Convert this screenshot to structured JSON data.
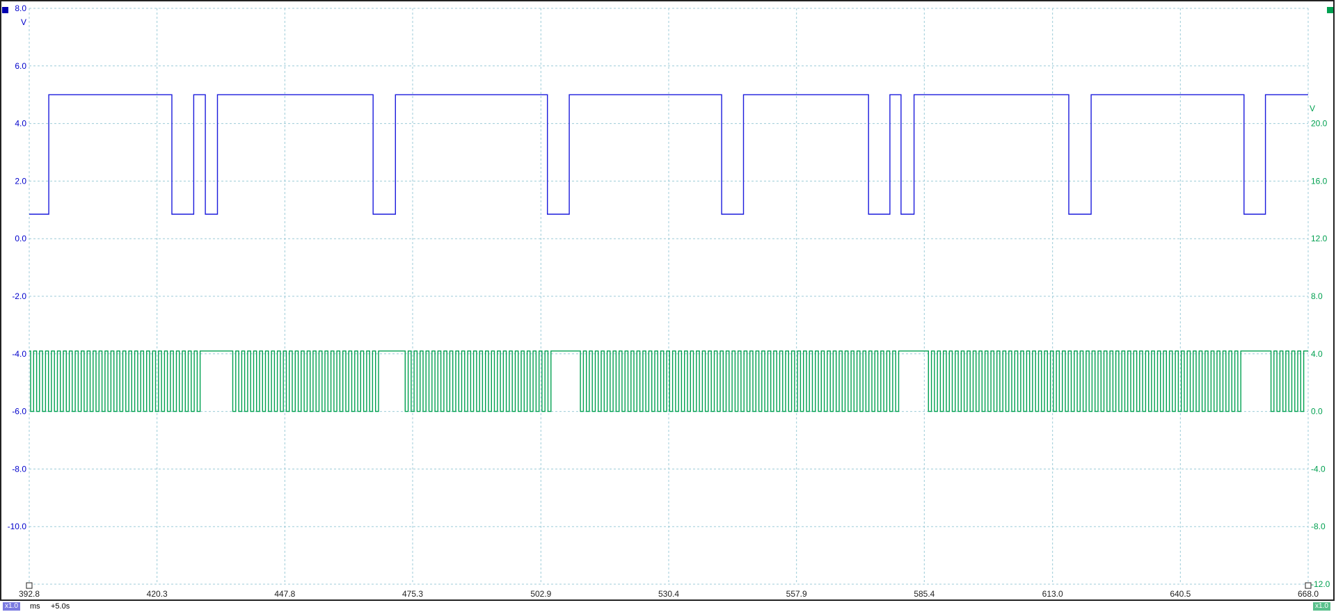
{
  "chart_data": {
    "type": "line",
    "x_unit": "ms",
    "x_range": [
      392.8,
      668.0
    ],
    "x_ticks": [
      "392.8",
      "420.3",
      "447.8",
      "475.3",
      "502.9",
      "530.4",
      "557.9",
      "585.4",
      "613.0",
      "640.5",
      "668.0"
    ],
    "axes": {
      "left": {
        "unit": "V",
        "range": [
          -12.0,
          8.0
        ],
        "ticks": [
          8.0,
          6.0,
          4.0,
          2.0,
          0.0,
          -2.0,
          -4.0,
          -6.0,
          -8.0,
          -10.0
        ],
        "tick_labels": [
          "8.0",
          "6.0",
          "4.0",
          "2.0",
          "0.0",
          "-2.0",
          "-4.0",
          "-6.0",
          "-8.0",
          "-10.0"
        ],
        "color": "#0000cc"
      },
      "right": {
        "unit": "V",
        "range": [
          -12.0,
          28.0
        ],
        "ticks": [
          20.0,
          16.0,
          12.0,
          8.0,
          4.0,
          0.0,
          -4.0,
          -8.0,
          -12.0
        ],
        "tick_labels": [
          "20.0",
          "16.0",
          "12.0",
          "8.0",
          "4.0",
          "0.0",
          "-4.0",
          "-8.0",
          "-12.0"
        ],
        "color": "#00a050"
      }
    },
    "grid": true,
    "series": [
      {
        "axis": "left",
        "color": "#1a1adc",
        "low": 0.85,
        "high": 5.0,
        "segments": [
          [
            392.8,
            0.85
          ],
          [
            397.0,
            5.0
          ],
          [
            423.5,
            0.85
          ],
          [
            428.2,
            5.0
          ],
          [
            430.7,
            0.85
          ],
          [
            433.3,
            5.0
          ],
          [
            466.8,
            0.85
          ],
          [
            471.6,
            5.0
          ],
          [
            504.3,
            0.85
          ],
          [
            509.0,
            5.0
          ],
          [
            541.8,
            0.85
          ],
          [
            546.5,
            5.0
          ],
          [
            573.4,
            0.85
          ],
          [
            578.0,
            5.0
          ],
          [
            580.4,
            0.85
          ],
          [
            583.2,
            5.0
          ],
          [
            616.5,
            0.85
          ],
          [
            621.3,
            5.0
          ],
          [
            654.2,
            0.85
          ],
          [
            658.8,
            5.0
          ],
          [
            668.0,
            5.0
          ]
        ]
      },
      {
        "axis": "right",
        "color": "#00a050",
        "low": 0.0,
        "high": 4.2,
        "pulse_period_ms": 1.28,
        "bursts": [
          [
            393.1,
            431.4
          ],
          [
            436.6,
            468.6
          ],
          [
            473.7,
            506.4
          ],
          [
            511.4,
            581.4
          ],
          [
            586.3,
            654.7
          ],
          [
            660.0,
            667.8
          ]
        ]
      }
    ]
  },
  "status": {
    "left_chip": "x1.0",
    "time_unit": "ms",
    "offset": "+5.0s",
    "right_chip": "x1.0"
  }
}
